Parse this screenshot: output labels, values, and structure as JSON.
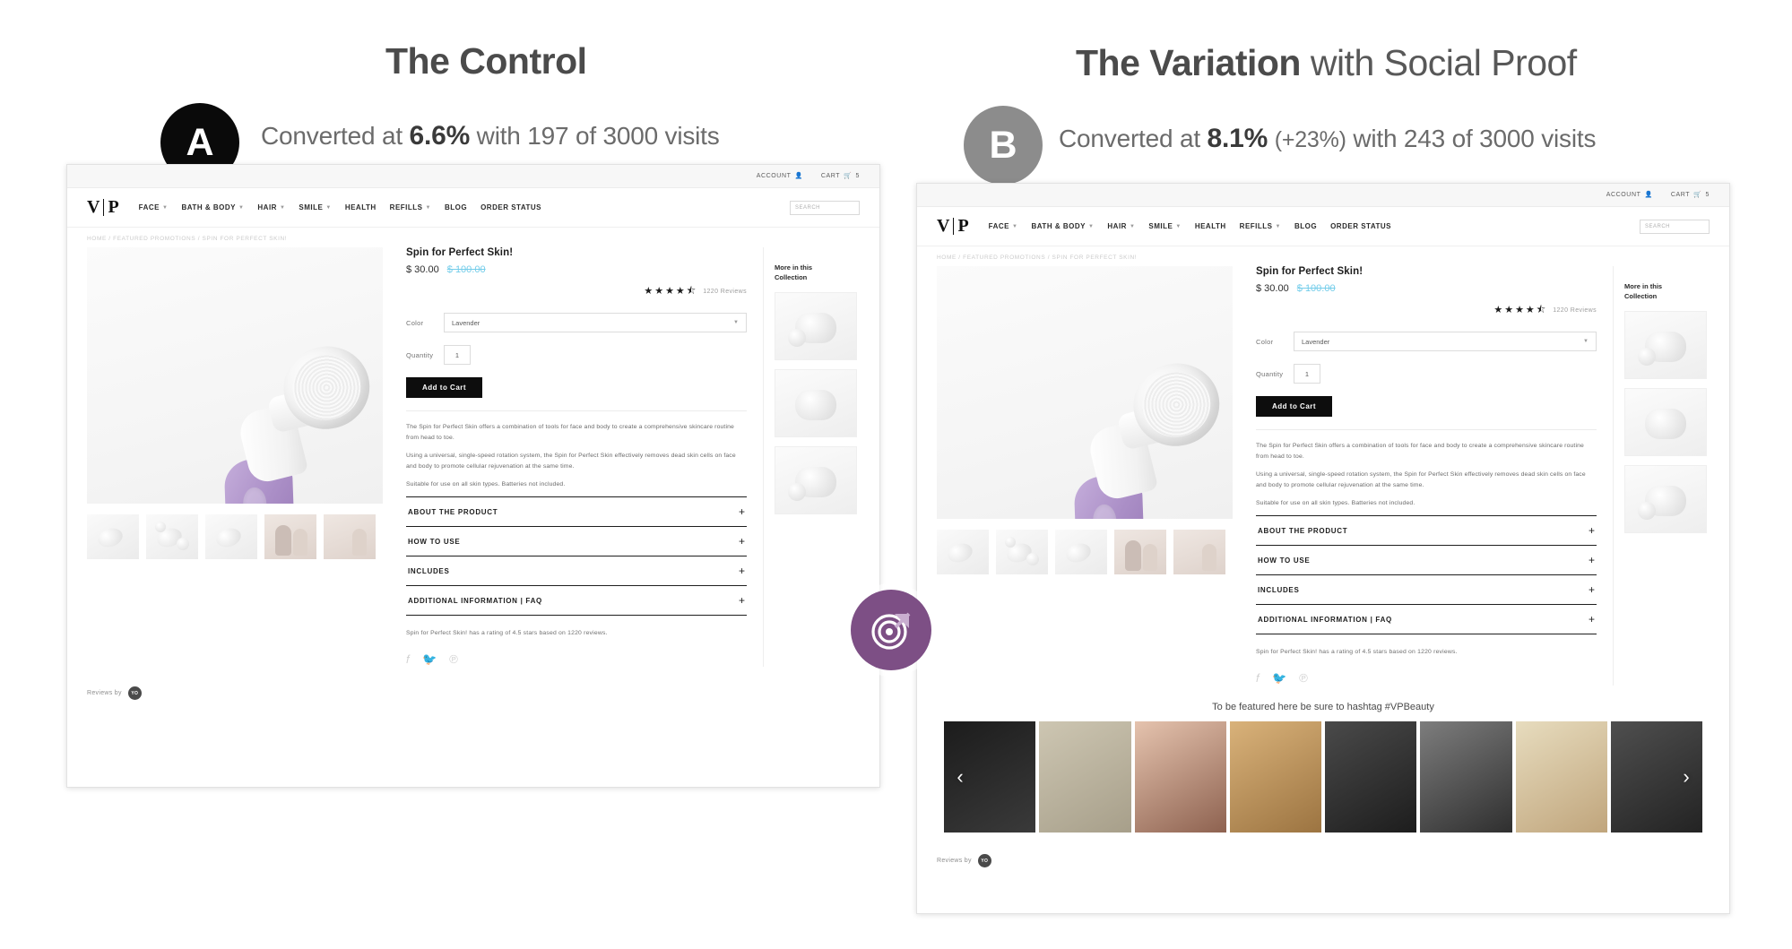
{
  "experiment": {
    "control": {
      "badge": "A",
      "title_strong": "The Control",
      "title_light": "",
      "sub_prefix": "Converted at ",
      "sub_rate": "6.6%",
      "sub_delta": "",
      "sub_suffix": " with 197 of 3000 visits",
      "badge_color": "#0a0a0a"
    },
    "variation": {
      "badge": "B",
      "title_strong": "The Variation",
      "title_light": " with Social Proof",
      "sub_prefix": "Converted at ",
      "sub_rate": "8.1%",
      "sub_delta": "(+23%)",
      "sub_suffix": " with 243 of 3000 visits",
      "badge_color": "#8c8c8c"
    },
    "connector_color": "#7d4f85",
    "target_icon": "target-cursor-icon"
  },
  "site": {
    "utility": {
      "account_label": "ACCOUNT",
      "account_icon": "person-icon",
      "cart_label": "CART",
      "cart_icon": "cart-icon",
      "cart_count": "5"
    },
    "logo": {
      "left": "V",
      "right": "P"
    },
    "nav": [
      {
        "label": "FACE",
        "has_caret": true
      },
      {
        "label": "BATH & BODY",
        "has_caret": true
      },
      {
        "label": "HAIR",
        "has_caret": true
      },
      {
        "label": "SMILE",
        "has_caret": true
      },
      {
        "label": "HEALTH",
        "has_caret": false
      },
      {
        "label": "REFILLS",
        "has_caret": true
      },
      {
        "label": "BLOG",
        "has_caret": false
      },
      {
        "label": "ORDER STATUS",
        "has_caret": false
      }
    ],
    "search_placeholder": "SEARCH",
    "breadcrumb": "HOME / FEATURED PROMOTIONS / SPIN FOR PERFECT SKIN!",
    "product": {
      "title": "Spin for Perfect Skin!",
      "price": "$ 30.00",
      "compare_at": "$ 100.00",
      "stars": "★★★★",
      "half_star": "★",
      "review_count": "1220 Reviews",
      "color_label": "Color",
      "color_value": "Lavender",
      "quantity_label": "Quantity",
      "quantity_value": "1",
      "add_to_cart": "Add to Cart",
      "description": [
        "The Spin for Perfect Skin offers a combination of tools for face and body to create a comprehensive skincare routine from head to toe.",
        "Using a universal, single-speed rotation system, the Spin for Perfect Skin effectively removes dead skin cells on face and body to promote cellular rejuvenation at the same time.",
        "Suitable for use on all skin types. Batteries not included."
      ],
      "accordions": [
        {
          "label": "ABOUT THE PRODUCT",
          "toggle": "+"
        },
        {
          "label": "HOW TO USE",
          "toggle": "+"
        },
        {
          "label": "INCLUDES",
          "toggle": "+"
        },
        {
          "label": "ADDITIONAL INFORMATION | FAQ",
          "toggle": "+"
        }
      ],
      "rating_sentence": "Spin for Perfect Skin! has a rating of 4.5 stars based on 1220 reviews.",
      "social": [
        {
          "name": "facebook-icon",
          "glyph": "f"
        },
        {
          "name": "twitter-icon",
          "glyph": "🐦"
        },
        {
          "name": "pinterest-icon",
          "glyph": "℗"
        }
      ]
    },
    "more_collection": {
      "title": "More in this\nCollection",
      "items": 3
    },
    "reviews_by": {
      "label": "Reviews by",
      "badge": "YO"
    },
    "ugc": {
      "caption": "To be featured here be sure to hashtag #VPBeauty",
      "prev_icon": "chevron-left-icon",
      "next_icon": "chevron-right-icon",
      "tiles": [
        "#151515",
        "#b5ad9d",
        "#c8a99a",
        "#b99a6e",
        "#2b2b2b",
        "#5d5d5d",
        "#d9c9a8",
        "#3a3a3a"
      ]
    }
  }
}
